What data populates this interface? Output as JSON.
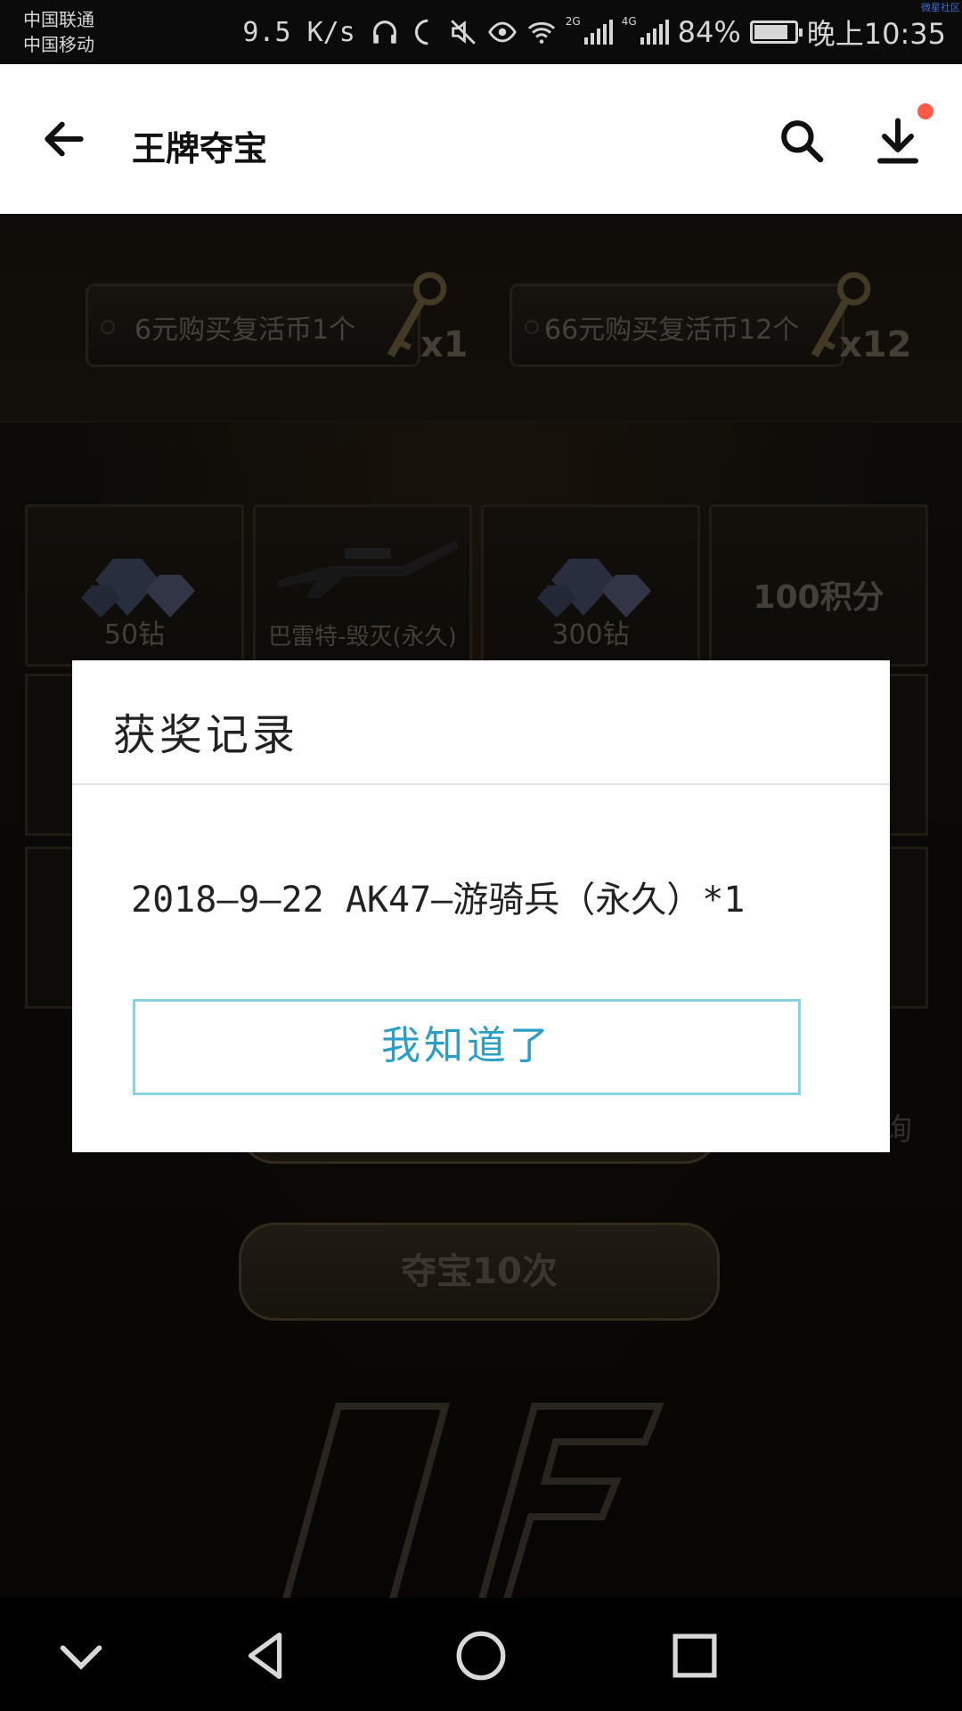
{
  "status_bar": {
    "carrier_1": "中国联通",
    "carrier_2": "中国移动",
    "speed": "9.5 K/s",
    "signal_1": "2G",
    "signal_2": "4G",
    "battery": "84%",
    "battery_level": 0.84,
    "time": "晚上10:35",
    "corner_tag": "微星社区",
    "icons": [
      "headphones-icon",
      "moon-icon",
      "mute-icon",
      "eye-icon",
      "wifi-icon",
      "signal-icon",
      "signal-icon",
      "battery-icon"
    ]
  },
  "app_bar": {
    "title": "王牌夺宝",
    "icons": [
      "back-arrow-icon",
      "search-icon",
      "download-icon"
    ],
    "notification_color": "#ff5a4a"
  },
  "game": {
    "buy_options": [
      {
        "label": "6元购买复活币1个",
        "qty": "x1"
      },
      {
        "label": "66元购买复活币12个",
        "qty": "x12"
      }
    ],
    "prizes": [
      {
        "label": "50钻"
      },
      {
        "label": "巴雷特-毁灭(永久)"
      },
      {
        "label": "300钻"
      },
      {
        "label": "100积分"
      }
    ],
    "side_text": "询",
    "draw_10_label": "夺宝10次"
  },
  "dialog": {
    "title": "获奖记录",
    "record": "2018—9—22  AK47—游骑兵（永久）*1",
    "confirm_label": "我知道了",
    "accent": "#2a9fc6"
  },
  "nav_bar": {
    "icons": [
      "chevron-down-icon",
      "back-triangle-icon",
      "home-circle-icon",
      "recents-square-icon"
    ]
  }
}
